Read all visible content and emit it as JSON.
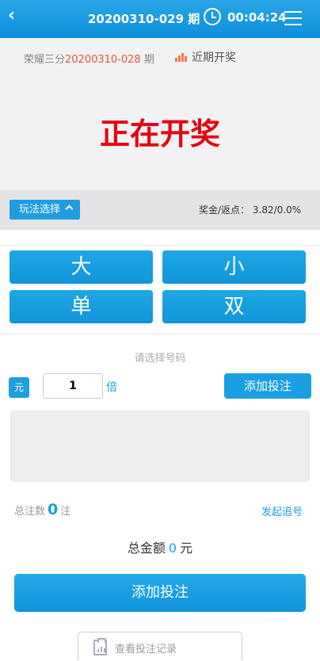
{
  "header": {
    "back_icon": "chevron-left-icon",
    "issue_label": "20200310-029 期",
    "clock_icon": "clock-icon",
    "countdown": "00:04:24",
    "menu_icon": "hamburger-menu-icon"
  },
  "previous": {
    "game_name": "荣耀三分",
    "issue_number": "20200310-028",
    "issue_suffix": " 期",
    "recent_draws_label": "近期开奖",
    "recent_draws_icon": "bar-chart-icon"
  },
  "draw_status": "正在开奖",
  "play": {
    "select_label": "玩法选择",
    "select_icon": "chevron-up-icon",
    "bonus_label": "奖金/返点：",
    "bonus_value": "3.82/0.0%"
  },
  "options": [
    {
      "label": "大"
    },
    {
      "label": "小"
    },
    {
      "label": "单"
    },
    {
      "label": "双"
    }
  ],
  "bet": {
    "hint": "请选择号码",
    "unit_tag": "元",
    "multiplier_value": "1",
    "multiplier_unit": "倍",
    "add_bet_small": "添加投注",
    "total_bets_prefix": "总注数",
    "total_bets_count": "0",
    "total_bets_unit": "注",
    "chase_label": "发起追号",
    "total_amount_label": "总金额",
    "total_amount_value": "0",
    "total_amount_unit": "元",
    "add_bet_big": "添加投注",
    "records_label": "查看投注记录",
    "records_icon": "clipboard-chart-icon"
  },
  "colors": {
    "primary": "#1e9ee0",
    "draw_red": "#e60012",
    "issue_red": "#e2553b"
  }
}
